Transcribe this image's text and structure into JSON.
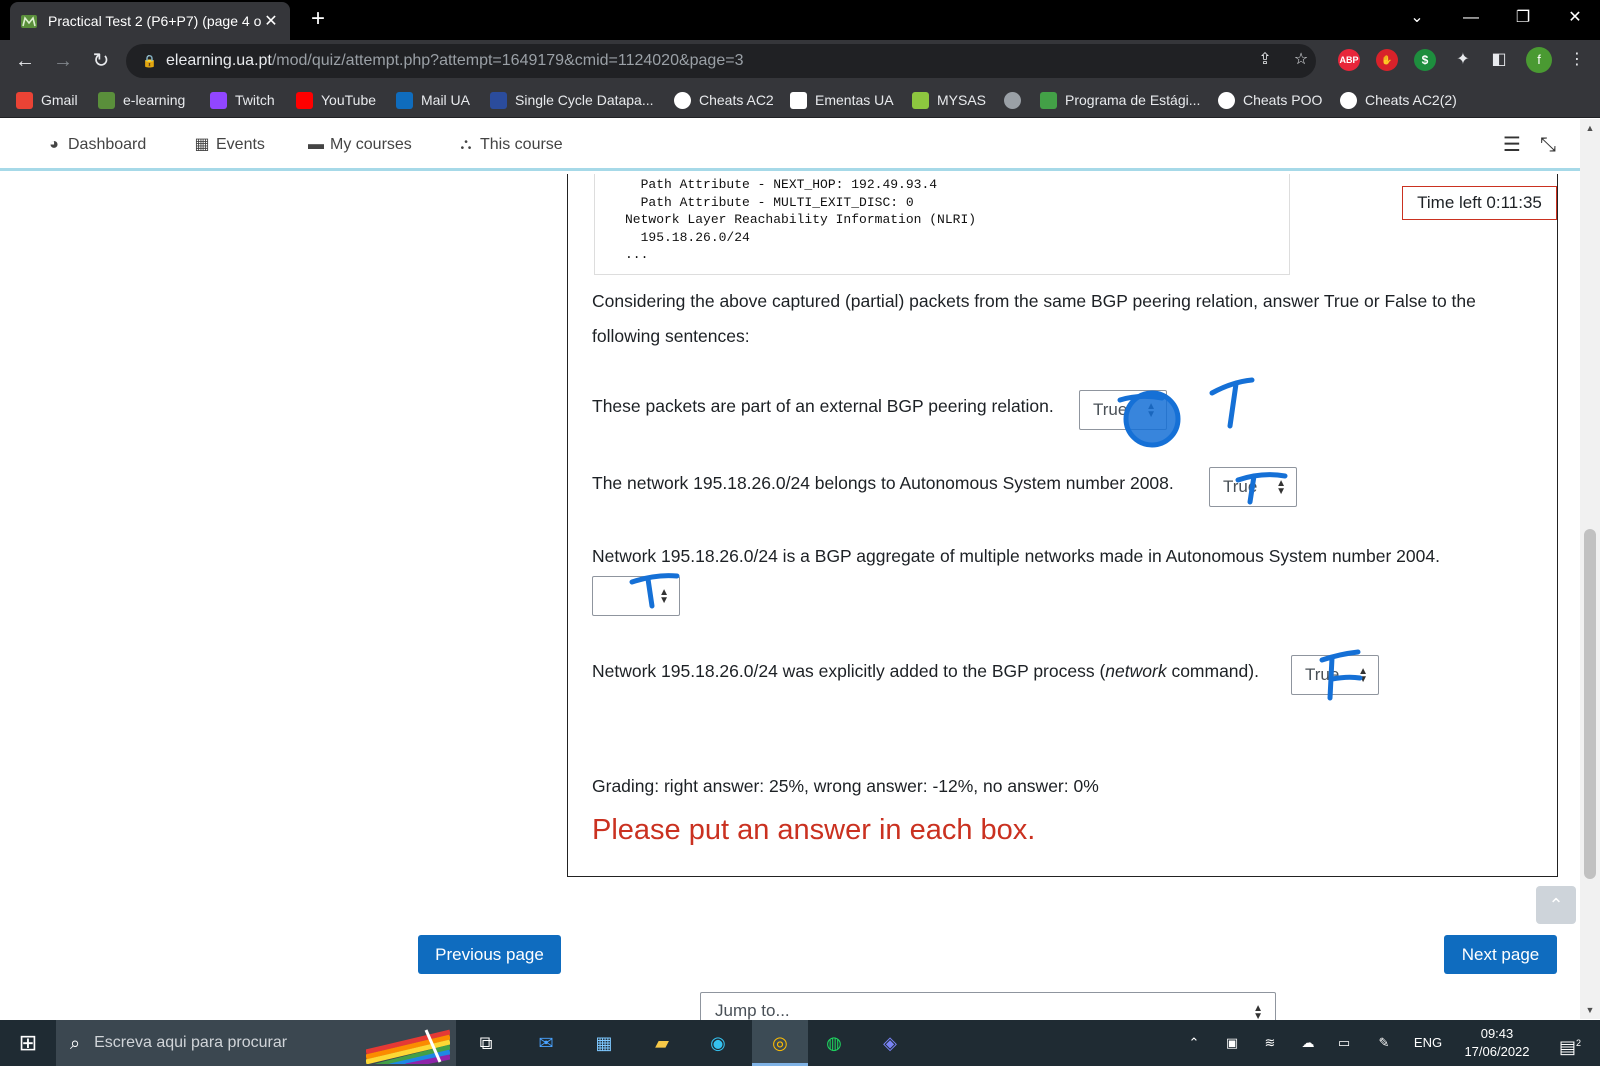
{
  "browser": {
    "tab_title": "Practical Test 2 (P6+P7) (page 4 o",
    "tab_close": "✕",
    "new_tab": "+",
    "url_host": "elearning.ua.pt",
    "url_path": "/mod/quiz/attempt.php?attempt=1649179&cmid=1124020&page=3",
    "profile_initial": "f",
    "ext_abp": "ABP",
    "ext_money": "$"
  },
  "bookmarks": [
    {
      "label": "Gmail",
      "icon": "gmail-icon",
      "color": "#ea4335"
    },
    {
      "label": "e-learning",
      "icon": "moodle-icon",
      "color": "#5a8f3b"
    },
    {
      "label": "Twitch",
      "icon": "twitch-icon",
      "color": "#9146ff"
    },
    {
      "label": "YouTube",
      "icon": "youtube-icon",
      "color": "#ff0000"
    },
    {
      "label": "Mail UA",
      "icon": "outlook-icon",
      "color": "#0f6cbd"
    },
    {
      "label": "Single Cycle Datapa...",
      "icon": "datapath-icon",
      "color": "#2b4c9c"
    },
    {
      "label": "Cheats AC2",
      "icon": "github-icon",
      "color": "#ffffff"
    },
    {
      "label": "Ementas UA",
      "icon": "ementas-icon",
      "color": "#ffffff"
    },
    {
      "label": "MYSAS",
      "icon": "mysas-icon",
      "color": "#8dc63f"
    },
    {
      "label": "",
      "icon": "globe-icon",
      "color": "#9aa0a6"
    },
    {
      "label": "Programa de Estági...",
      "icon": "programa-icon",
      "color": "#43a047"
    },
    {
      "label": "Cheats POO",
      "icon": "github-icon",
      "color": "#ffffff"
    },
    {
      "label": "Cheats AC2(2)",
      "icon": "github-icon",
      "color": "#ffffff"
    }
  ],
  "moodle_nav": {
    "dashboard": "Dashboard",
    "events": "Events",
    "my_courses": "My courses",
    "this_course": "This course"
  },
  "timer": "Time left 0:11:35",
  "code_lines": "  Path Attribute - NEXT_HOP: 192.49.93.4\n  Path Attribute - MULTI_EXIT_DISC: 0\nNetwork Layer Reachability Information (NLRI)\n  195.18.26.0/24\n...",
  "question": {
    "intro_line1": "Considering the above captured (partial) packets from the same BGP peering relation, answer True or False to the",
    "intro_line2": "following sentences:",
    "s1": "These packets are part of an external BGP peering relation.",
    "s1_value": "True",
    "s2": "The network 195.18.26.0/24 belongs to Autonomous System number 2008.",
    "s2_value": "True",
    "s3": "Network 195.18.26.0/24 is a BGP aggregate of multiple networks made in Autonomous System number 2004.",
    "s3_value": "",
    "s4_pre": "Network 195.18.26.0/24 was explicitly added to the BGP process (",
    "s4_em": "network",
    "s4_post": " command).",
    "s4_value": "True"
  },
  "grading": "Grading: right answer: 25%, wrong answer: -12%, no answer: 0%",
  "error": "Please put an answer in each box.",
  "buttons": {
    "previous": "Previous page",
    "next": "Next page"
  },
  "jump_to": "Jump to...",
  "taskbar": {
    "search_placeholder": "Escreva aqui para procurar",
    "lang": "ENG",
    "time": "09:43",
    "date": "17/06/2022",
    "notif_count": "2"
  },
  "colors": {
    "moodle_primary": "#0f6cbf",
    "error_red": "#ca3120",
    "ink_blue": "#1570d6",
    "nav_border": "#a6d9e8"
  }
}
